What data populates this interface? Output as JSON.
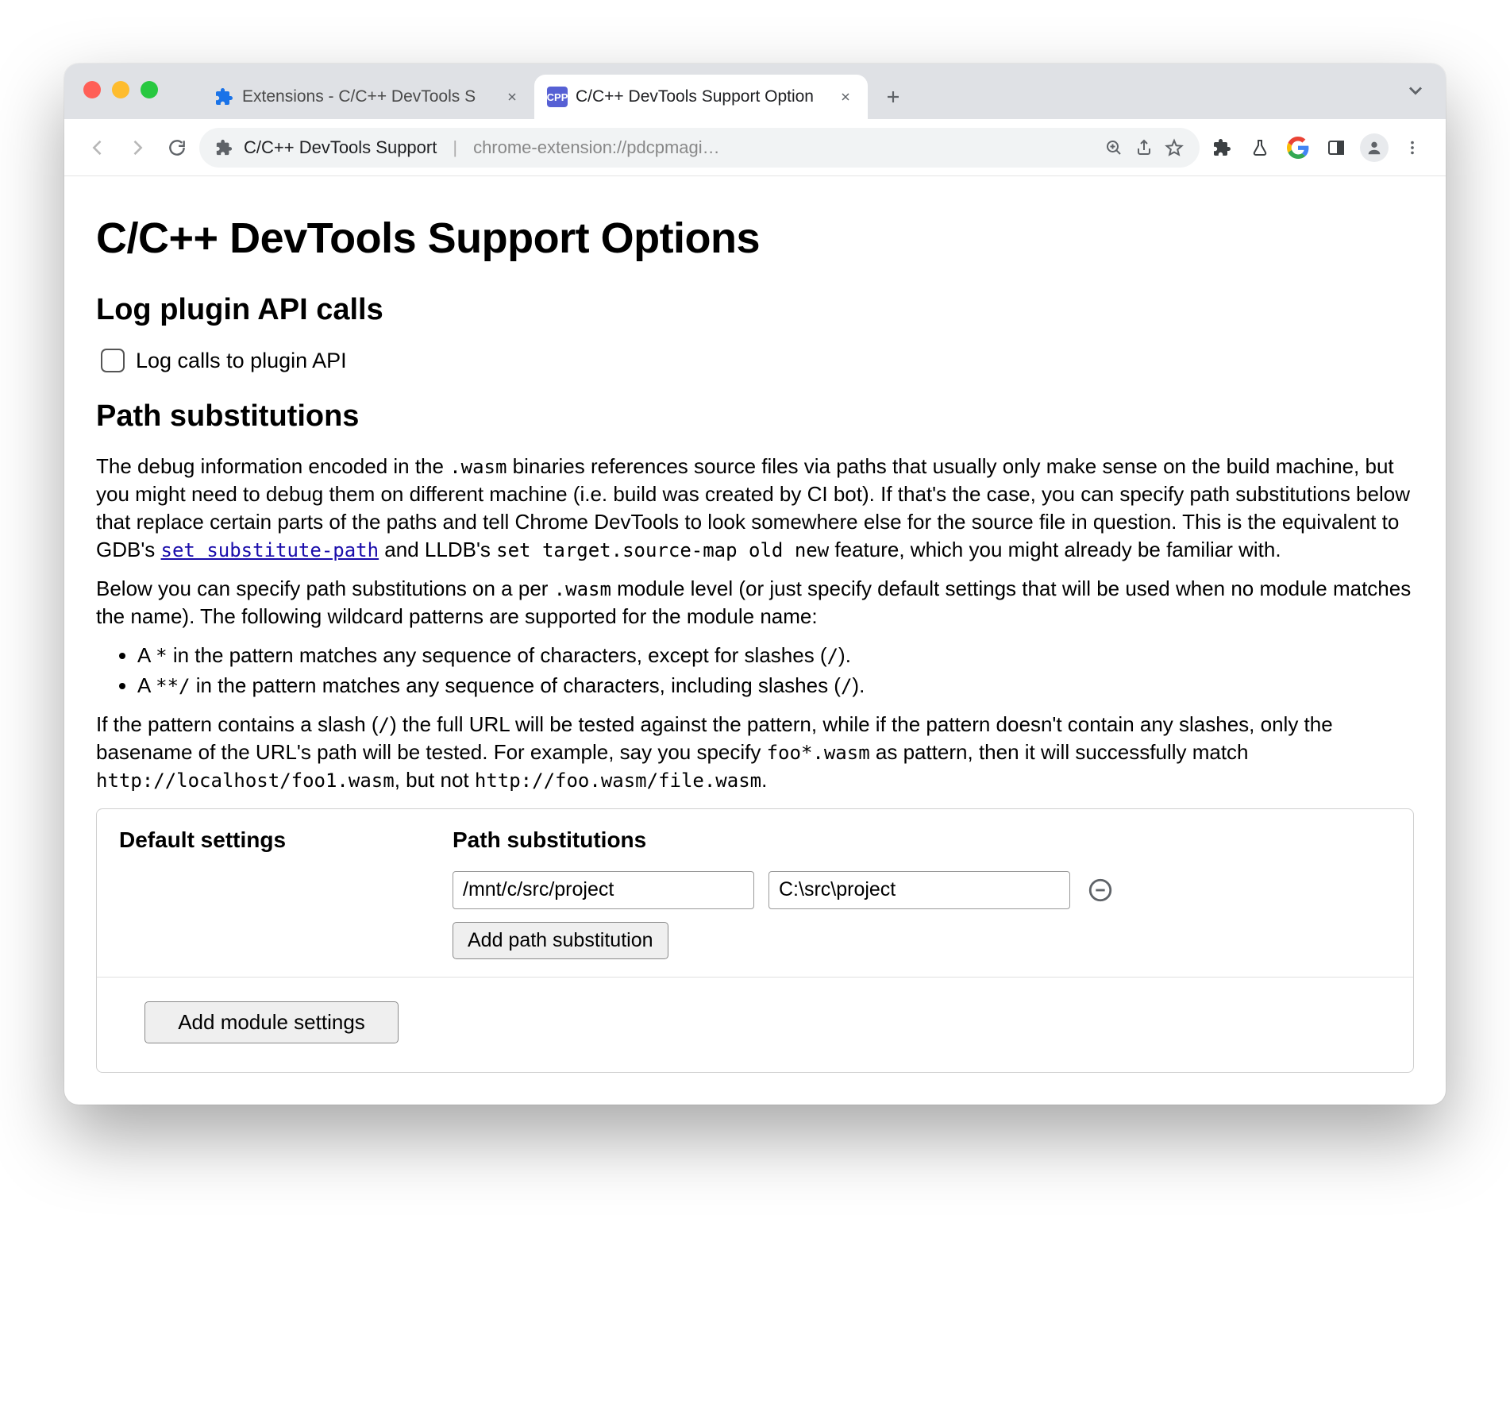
{
  "browser": {
    "tabs": [
      {
        "title": "Extensions - C/C++ DevTools S",
        "active": false
      },
      {
        "title": "C/C++ DevTools Support Option",
        "active": true
      }
    ],
    "omnibox": {
      "ext_name": "C/C++ DevTools Support",
      "url": "chrome-extension://pdcpmagi…"
    }
  },
  "page": {
    "h1": "C/C++ DevTools Support Options",
    "section_log": {
      "heading": "Log plugin API calls",
      "checkbox_label": "Log calls to plugin API",
      "checked": false
    },
    "section_path": {
      "heading": "Path substitutions",
      "para1_pre": "The debug information encoded in the ",
      "para1_code1": ".wasm",
      "para1_mid": " binaries references source files via paths that usually only make sense on the build machine, but you might need to debug them on different machine (i.e. build was created by CI bot). If that's the case, you can specify path substitutions below that replace certain parts of the paths and tell Chrome DevTools to look somewhere else for the source file in question. This is the equivalent to GDB's ",
      "para1_link": "set substitute-path",
      "para1_after_link": " and LLDB's ",
      "para1_code2": "set target.source-map old new",
      "para1_end": " feature, which you might already be familiar with.",
      "para2_pre": "Below you can specify path substitutions on a per ",
      "para2_code": ".wasm",
      "para2_end": " module level (or just specify default settings that will be used when no module matches the name). The following wildcard patterns are supported for the module name:",
      "bullet1_a": "A ",
      "bullet1_code": "*",
      "bullet1_b": " in the pattern matches any sequence of characters, except for slashes (",
      "bullet1_slash": "/",
      "bullet1_c": ").",
      "bullet2_a": "A ",
      "bullet2_code": "**/",
      "bullet2_b": " in the pattern matches any sequence of characters, including slashes (",
      "bullet2_slash": "/",
      "bullet2_c": ").",
      "para3_a": "If the pattern contains a slash (",
      "para3_slash": "/",
      "para3_b": ") the full URL will be tested against the pattern, while if the pattern doesn't contain any slashes, only the basename of the URL's path will be tested. For example, say you specify ",
      "para3_code1": "foo*.wasm",
      "para3_c": " as pattern, then it will successfully match ",
      "para3_code2": "http://localhost/foo1.wasm",
      "para3_d": ", but not ",
      "para3_code3": "http://foo.wasm/file.wasm",
      "para3_e": "."
    },
    "settings": {
      "default_label": "Default settings",
      "path_sub_label": "Path substitutions",
      "from_value": "/mnt/c/src/project",
      "to_value": "C:\\src\\project",
      "add_path_btn": "Add path substitution",
      "add_module_btn": "Add module settings"
    }
  }
}
